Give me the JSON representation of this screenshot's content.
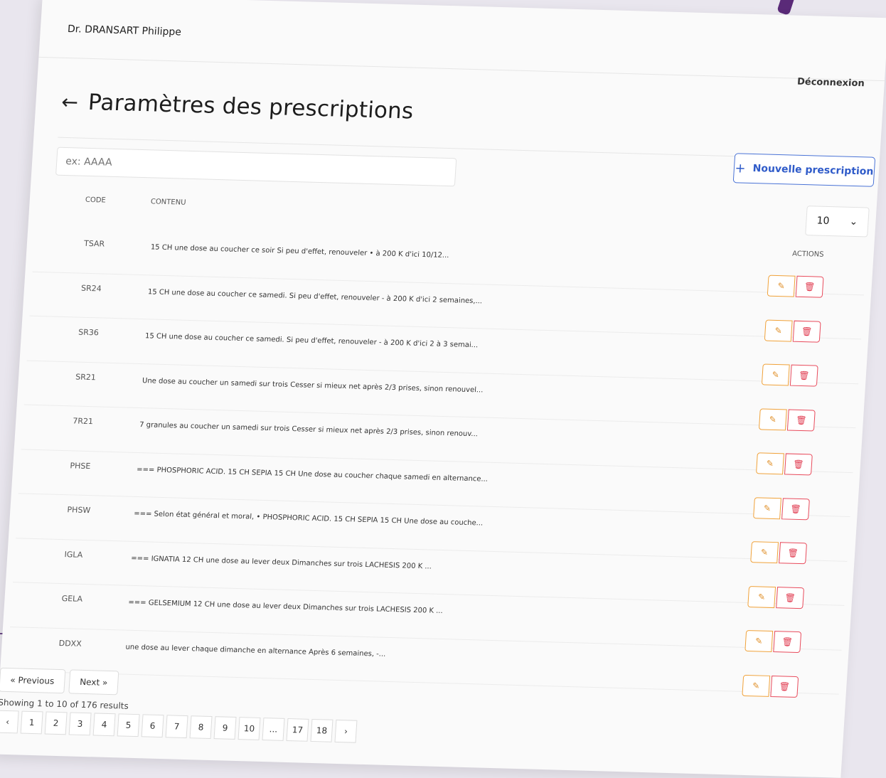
{
  "header": {
    "doctor": "Dr. DRANSART Philippe",
    "logout": "Déconnexion"
  },
  "page": {
    "back_icon": "←",
    "title": "Paramètres des prescriptions"
  },
  "toolbar": {
    "new_button_icon": "+",
    "new_button": "Nouvelle prescription",
    "search_placeholder": "ex: AAAA",
    "page_size": "10",
    "page_size_icon": "⌄"
  },
  "table": {
    "headers": {
      "code": "CODE",
      "content": "CONTENU",
      "actions": "ACTIONS"
    },
    "edit_icon": "✎",
    "delete_icon": "🗑",
    "rows": [
      {
        "code": "TSAR",
        "content": "15 CH une dose au coucher ce soir Si peu d'effet, renouveler • à 200 K d'ici 10/12..."
      },
      {
        "code": "SR24",
        "content": "15 CH une dose au coucher ce samedi. Si peu d'effet, renouveler - à 200 K d'ici 2 semaines,..."
      },
      {
        "code": "SR36",
        "content": "15 CH une dose au coucher ce samedi. Si peu d'effet, renouveler - à 200 K d'ici 2 à 3 semai..."
      },
      {
        "code": "SR21",
        "content": "Une dose au coucher un samedi sur trois Cesser si mieux net après 2/3 prises, sinon renouvel..."
      },
      {
        "code": "7R21",
        "content": "7 granules au coucher un samedi sur trois Cesser si mieux net après 2/3 prises, sinon renouv..."
      },
      {
        "code": "PHSE",
        "content": "=== PHOSPHORIC ACID. 15 CH SEPIA 15 CH Une dose au coucher chaque samedi en alternance..."
      },
      {
        "code": "PHSW",
        "content": "=== Selon état général et moral, • PHOSPHORIC ACID. 15 CH SEPIA 15 CH Une dose au couche..."
      },
      {
        "code": "IGLA",
        "content": "=== IGNATIA 12 CH une dose au lever deux Dimanches sur trois LACHESIS 200 K ..."
      },
      {
        "code": "GELA",
        "content": "=== GELSEMIUM 12 CH une dose au lever deux Dimanches sur trois LACHESIS 200 K ..."
      },
      {
        "code": "DDXX",
        "content": "une dose au lever chaque dimanche en alternance Après 6 semaines, -..."
      }
    ]
  },
  "pagination": {
    "previous": "« Previous",
    "next": "Next »",
    "results": "Showing 1 to 10 of 176 results",
    "prev_icon": "‹",
    "next_icon": "›",
    "pages": [
      "1",
      "2",
      "3",
      "4",
      "5",
      "6",
      "7",
      "8",
      "9",
      "10",
      "...",
      "17",
      "18"
    ]
  }
}
